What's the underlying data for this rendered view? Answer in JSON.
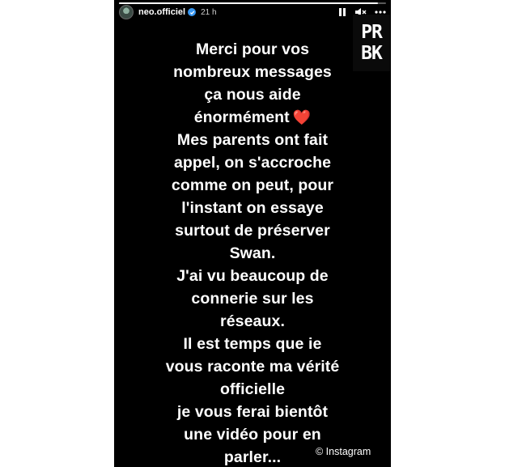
{
  "header": {
    "username": "neo.officiel",
    "time": "21 h",
    "story_progress": 0.97
  },
  "controls": {
    "pause_icon": "pause-icon",
    "mute_icon": "speaker-muted-icon",
    "more_icon": "more-dots-icon"
  },
  "message": {
    "lines": [
      "Merci pour vos",
      "nombreux messages",
      "ça nous aide",
      "énormément",
      "Mes parents ont fait",
      "appel, on s'accroche",
      "comme on peut, pour",
      "l'instant on essaye",
      "surtout de préserver",
      "Swan.",
      "J'ai vu beaucoup de",
      "connerie sur les",
      "réseaux.",
      "Il est temps que ie",
      "vous raconte ma vérité",
      "officielle",
      "je vous ferai bientôt",
      "une vidéo pour en",
      "parler..."
    ],
    "heart": "❤️"
  },
  "watermark": {
    "logo_line1": "PR",
    "logo_line2": "BK",
    "credit": "© Instagram"
  },
  "colors": {
    "story_bg": "#000000",
    "text": "#ffffff",
    "heart": "#e8283b",
    "verified": "#3897f0"
  }
}
